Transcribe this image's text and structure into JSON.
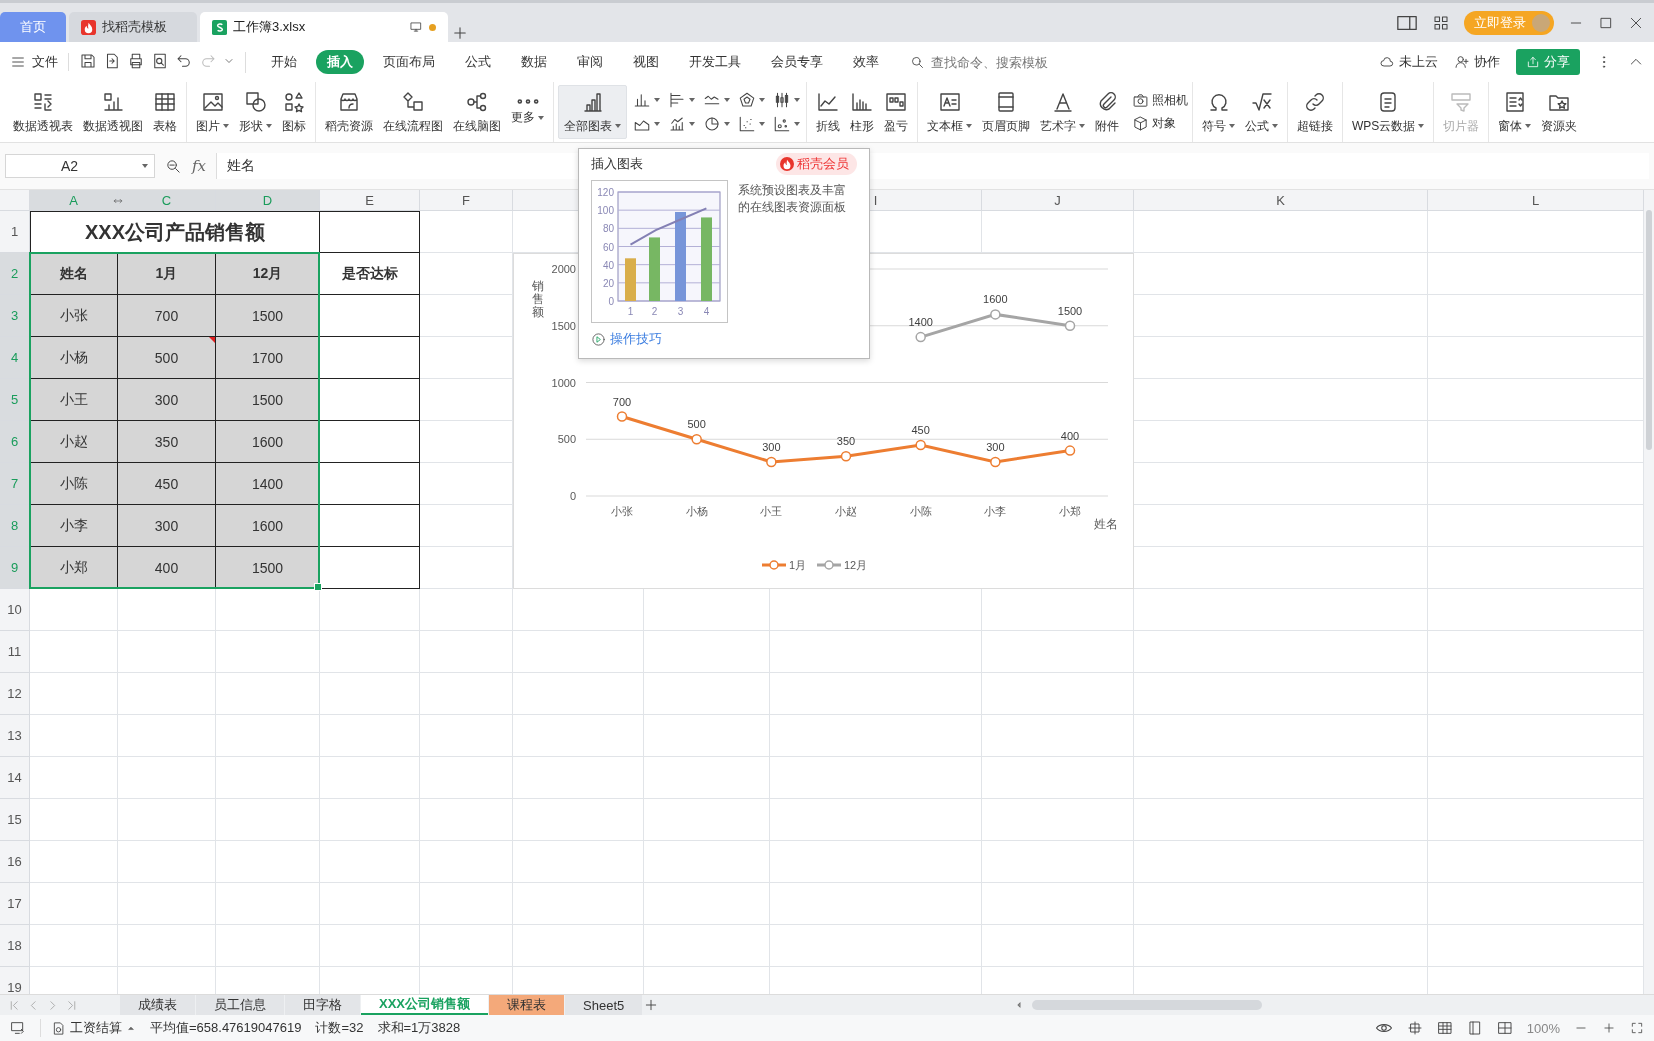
{
  "title_bar": {
    "tabs": [
      {
        "label": "首页",
        "kind": "home",
        "selected": false,
        "unsaved": false
      },
      {
        "label": "找稻壳模板",
        "kind": "docer",
        "selected": false,
        "unsaved": false
      },
      {
        "label": "工作簿3.xlsx",
        "kind": "workbook",
        "selected": true,
        "unsaved": true
      }
    ],
    "login": "立即登录"
  },
  "menu": {
    "file": "文件",
    "quick_access": [
      {
        "disabled": false
      },
      {
        "disabled": false
      },
      {
        "disabled": false
      },
      {
        "disabled": false
      },
      {
        "disabled": false
      },
      {
        "disabled": true
      },
      {
        "disabled": false
      }
    ],
    "tabs": [
      {
        "label": "开始",
        "selected": false
      },
      {
        "label": "插入",
        "selected": true
      },
      {
        "label": "页面布局",
        "selected": false
      },
      {
        "label": "公式",
        "selected": false
      },
      {
        "label": "数据",
        "selected": false
      },
      {
        "label": "审阅",
        "selected": false
      },
      {
        "label": "视图",
        "selected": false
      },
      {
        "label": "开发工具",
        "selected": false
      },
      {
        "label": "会员专享",
        "selected": false
      },
      {
        "label": "效率",
        "selected": false
      }
    ],
    "search": {
      "placeholder": "查找命令、搜索模板"
    },
    "cloud": "未上云",
    "collab": "协作",
    "share": "分享"
  },
  "ribbon": {
    "groups": [
      {
        "items": [
          {
            "kind": "large",
            "label": "数据透视表",
            "dropdown": false,
            "active": false,
            "disabled": false
          },
          {
            "kind": "large",
            "label": "数据透视图",
            "dropdown": false,
            "active": false,
            "disabled": false
          },
          {
            "kind": "large",
            "label": "表格",
            "dropdown": false,
            "active": false,
            "disabled": false
          }
        ]
      },
      {
        "items": [
          {
            "kind": "large",
            "label": "图片",
            "dropdown": true,
            "active": false,
            "disabled": false
          },
          {
            "kind": "large",
            "label": "形状",
            "dropdown": true,
            "active": false,
            "disabled": false
          },
          {
            "kind": "large",
            "label": "图标",
            "dropdown": false,
            "active": false,
            "disabled": false
          }
        ]
      },
      {
        "items": [
          {
            "kind": "large",
            "label": "稻壳资源",
            "dropdown": false,
            "active": false,
            "disabled": false
          },
          {
            "kind": "large",
            "label": "在线流程图",
            "dropdown": false,
            "active": false,
            "disabled": false
          },
          {
            "kind": "large",
            "label": "在线脑图",
            "dropdown": false,
            "active": false,
            "disabled": false
          },
          {
            "kind": "large",
            "label": "更多",
            "dropdown": true,
            "active": false,
            "disabled": false
          }
        ]
      },
      {
        "items": [
          {
            "kind": "large",
            "label": "全部图表",
            "dropdown": true,
            "active": true,
            "disabled": false
          },
          {
            "kind": "mini",
            "dropdown": true
          },
          {
            "kind": "mini",
            "dropdown": true
          },
          {
            "kind": "mini",
            "dropdown": true
          },
          {
            "kind": "mini",
            "dropdown": true
          },
          {
            "kind": "mini",
            "dropdown": true
          },
          {
            "kind": "mini",
            "dropdown": true
          },
          {
            "kind": "mini",
            "dropdown": true
          },
          {
            "kind": "mini",
            "dropdown": true
          },
          {
            "kind": "mini",
            "dropdown": true
          },
          {
            "kind": "mini",
            "dropdown": true
          }
        ]
      },
      {
        "items": [
          {
            "kind": "large",
            "label": "折线",
            "dropdown": false,
            "active": false,
            "disabled": false
          },
          {
            "kind": "large",
            "label": "柱形",
            "dropdown": false,
            "active": false,
            "disabled": false
          },
          {
            "kind": "large",
            "label": "盈亏",
            "dropdown": false,
            "active": false,
            "disabled": false
          }
        ]
      },
      {
        "items": [
          {
            "kind": "large",
            "label": "文本框",
            "dropdown": true,
            "active": false,
            "disabled": false
          },
          {
            "kind": "large",
            "label": "页眉页脚",
            "dropdown": false,
            "active": false,
            "disabled": false
          },
          {
            "kind": "large",
            "label": "艺术字",
            "dropdown": true,
            "active": false,
            "disabled": false
          },
          {
            "kind": "large",
            "label": "附件",
            "dropdown": false,
            "active": false,
            "disabled": false
          },
          {
            "kind": "small",
            "label": "照相机"
          },
          {
            "kind": "small",
            "label": "对象"
          }
        ]
      },
      {
        "items": [
          {
            "kind": "large",
            "label": "符号",
            "dropdown": true,
            "active": false,
            "disabled": false
          },
          {
            "kind": "large",
            "label": "公式",
            "dropdown": true,
            "active": false,
            "disabled": false
          }
        ]
      },
      {
        "items": [
          {
            "kind": "large",
            "label": "超链接",
            "dropdown": false,
            "active": false,
            "disabled": false
          }
        ]
      },
      {
        "items": [
          {
            "kind": "large",
            "label": "WPS云数据",
            "dropdown": true,
            "active": false,
            "disabled": false
          }
        ]
      },
      {
        "items": [
          {
            "kind": "large",
            "label": "切片器",
            "dropdown": false,
            "active": false,
            "disabled": true
          }
        ]
      },
      {
        "items": [
          {
            "kind": "large",
            "label": "窗体",
            "dropdown": true,
            "active": false,
            "disabled": false
          },
          {
            "kind": "large",
            "label": "资源夹",
            "dropdown": false,
            "active": false,
            "disabled": false
          }
        ]
      }
    ]
  },
  "formula_bar": {
    "name_box": "A2",
    "function_label": "fx",
    "content": "姓名"
  },
  "sheet": {
    "columns": [
      {
        "label": "A",
        "selected": true
      },
      {
        "label": "C",
        "selected": true
      },
      {
        "label": "D",
        "selected": true
      },
      {
        "label": "E",
        "selected": false
      },
      {
        "label": "F",
        "selected": false
      },
      {},
      {},
      {
        "label": "I",
        "selected": false
      },
      {
        "label": "J",
        "selected": false
      },
      {
        "label": "K",
        "selected": false
      },
      {
        "label": "L",
        "selected": false
      }
    ],
    "rows": [
      {
        "number": "1",
        "selected": false
      },
      {
        "number": "2",
        "selected": true
      },
      {
        "number": "3",
        "selected": true
      },
      {
        "number": "4",
        "selected": true
      },
      {
        "number": "5",
        "selected": true
      },
      {
        "number": "6",
        "selected": true
      },
      {
        "number": "7",
        "selected": true
      },
      {
        "number": "8",
        "selected": true
      },
      {
        "number": "9",
        "selected": true
      },
      {
        "number": "10",
        "selected": false
      },
      {
        "number": "11",
        "selected": false
      },
      {
        "number": "12",
        "selected": false
      },
      {
        "number": "13",
        "selected": false
      },
      {
        "number": "14",
        "selected": false
      },
      {
        "number": "15",
        "selected": false
      },
      {
        "number": "16",
        "selected": false
      },
      {
        "number": "17",
        "selected": false
      },
      {
        "number": "18",
        "selected": false
      },
      {
        "number": "19",
        "selected": false
      }
    ],
    "table": {
      "title": "XXX公司产品销售额",
      "header": [
        "姓名",
        "1月",
        "12月",
        "是否达标"
      ],
      "body": [
        [
          {
            "text": "小张",
            "comment": false
          },
          {
            "text": "700",
            "comment": false
          },
          {
            "text": "1500",
            "comment": false
          }
        ],
        [
          {
            "text": "小杨",
            "comment": false
          },
          {
            "text": "500",
            "comment": true
          },
          {
            "text": "1700",
            "comment": false
          }
        ],
        [
          {
            "text": "小王",
            "comment": false
          },
          {
            "text": "300",
            "comment": false
          },
          {
            "text": "1500",
            "comment": false
          }
        ],
        [
          {
            "text": "小赵",
            "comment": false
          },
          {
            "text": "350",
            "comment": false
          },
          {
            "text": "1600",
            "comment": false
          }
        ],
        [
          {
            "text": "小陈",
            "comment": false
          },
          {
            "text": "450",
            "comment": false
          },
          {
            "text": "1400",
            "comment": false
          }
        ],
        [
          {
            "text": "小李",
            "comment": false
          },
          {
            "text": "300",
            "comment": false
          },
          {
            "text": "1600",
            "comment": false
          }
        ],
        [
          {
            "text": "小郑",
            "comment": false
          },
          {
            "text": "400",
            "comment": false
          },
          {
            "text": "1500",
            "comment": false
          }
        ]
      ]
    },
    "chart": {
      "chart_data": {
        "type": "line",
        "xlabel": "姓名",
        "ylabel": "销售额",
        "categories": [
          "小张",
          "小杨",
          "小王",
          "小赵",
          "小陈",
          "小李",
          "小郑"
        ],
        "series": [
          {
            "name": "1月",
            "color": "#ed7d31",
            "marker": "circle",
            "values": [
              700,
              500,
              300,
              350,
              450,
              300,
              400
            ]
          },
          {
            "name": "12月",
            "color": "#a5a5a5",
            "marker": "circle",
            "values": [
              null,
              null,
              null,
              null,
              1400,
              1600,
              1500
            ]
          }
        ],
        "ylim": [
          0,
          2000
        ],
        "yticks": [
          0,
          500,
          1000,
          1500,
          2000
        ],
        "grid": true,
        "legend": "bottom",
        "data_labels": true
      }
    }
  },
  "chart_popup": {
    "title": "插入图表",
    "badge": "稻壳会员",
    "description": "系统预设图表及丰富的在线图表资源面板",
    "link": "操作技巧",
    "chart_data": {
      "type": "bar",
      "categories": [
        "1",
        "2",
        "3",
        "4"
      ],
      "series": [
        {
          "type": "bar",
          "colors": [
            "#d9ae4b",
            "#77b763",
            "#7795d9",
            "#77b763"
          ],
          "values": [
            47,
            70,
            98,
            92
          ]
        },
        {
          "type": "line",
          "color": "#8480b4",
          "values": [
            62,
            78,
            90,
            102
          ]
        }
      ],
      "ylim": [
        0,
        120
      ],
      "yticks": [
        0,
        20,
        40,
        60,
        80,
        100,
        120
      ],
      "grid": true
    }
  },
  "sheet_tabs": [
    {
      "label": "成绩表",
      "selected": false
    },
    {
      "label": "员工信息",
      "selected": false
    },
    {
      "label": "田字格",
      "selected": false
    },
    {
      "label": "XXX公司销售额",
      "selected": true
    },
    {
      "label": "课程表",
      "selected": false,
      "color": "#f4a97a"
    },
    {
      "label": "Sheet5",
      "selected": false
    }
  ],
  "status_bar": {
    "macro": "工资结算",
    "stats": [
      "平均值=658.47619047619",
      "计数=32",
      "求和=1万3828"
    ],
    "zoom": "100%"
  }
}
